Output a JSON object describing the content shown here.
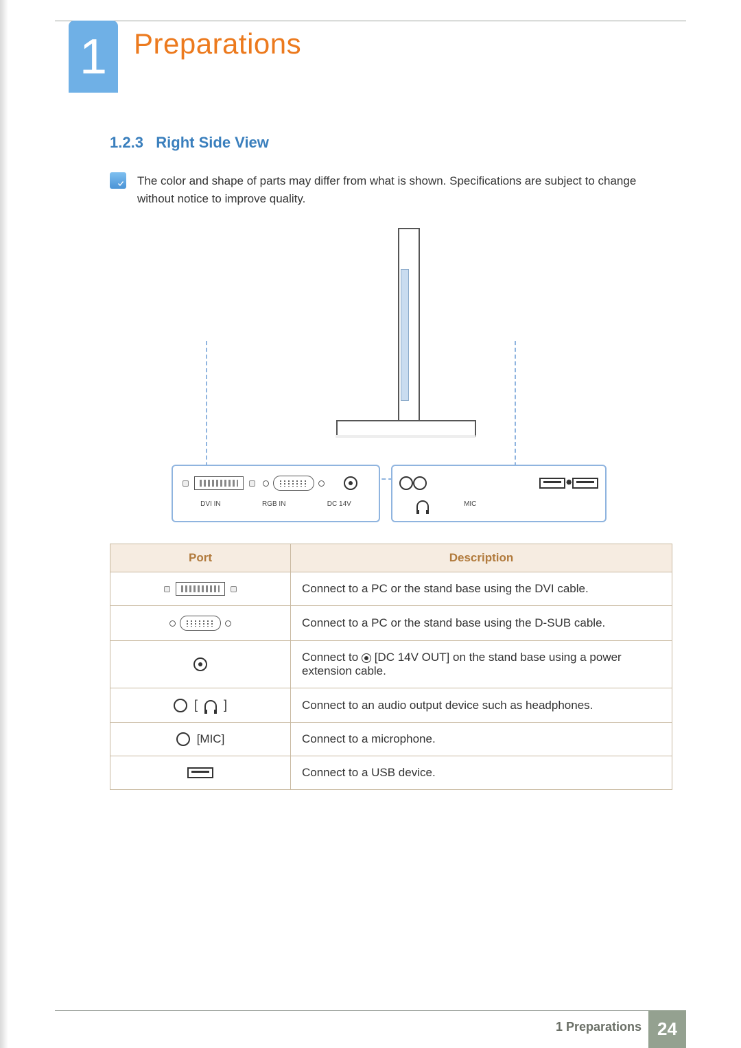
{
  "chapter": {
    "number": "1",
    "title": "Preparations"
  },
  "section": {
    "number": "1.2.3",
    "title": "Right Side View"
  },
  "note": "The color and shape of parts may differ from what is shown. Specifications are subject to change without notice to improve quality.",
  "panel_labels": {
    "dvi": "DVI IN",
    "rgb": "RGB IN",
    "dc": "DC 14V",
    "mic": "MIC"
  },
  "table": {
    "headers": {
      "port": "Port",
      "desc": "Description"
    },
    "rows": [
      {
        "port_name": "dvi-port",
        "desc": "Connect to a PC or the stand base using the DVI cable."
      },
      {
        "port_name": "vga-port",
        "desc": "Connect to a PC or the stand base using the D-SUB cable."
      },
      {
        "port_name": "dc-port",
        "desc_pre": "Connect to ",
        "desc_mid": "[DC 14V OUT] on the stand base using a power extension cable."
      },
      {
        "port_name": "headphone-port",
        "label_bracket": "[ ",
        "label_bracket_end": " ]",
        "desc": "Connect to an audio output device such as headphones."
      },
      {
        "port_name": "mic-port",
        "label": "[MIC]",
        "desc": "Connect to a microphone."
      },
      {
        "port_name": "usb-port",
        "desc": "Connect to a USB device."
      }
    ]
  },
  "footer": {
    "label": "1 Preparations",
    "page": "24"
  }
}
